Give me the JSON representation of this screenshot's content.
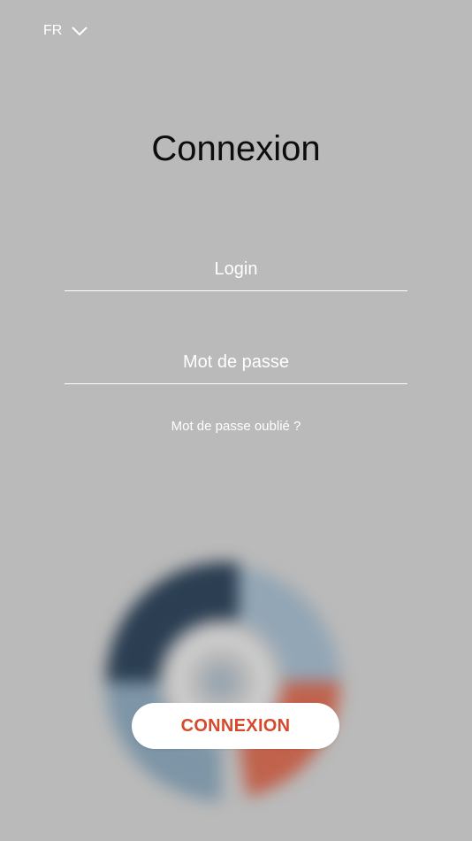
{
  "language": {
    "selected": "FR",
    "chevron_icon": "chevron-down-icon"
  },
  "title": "Connexion",
  "form": {
    "login_placeholder": "Login",
    "password_placeholder": "Mot de passe",
    "forgot_password": "Mot de passe oublié ?"
  },
  "actions": {
    "submit_label": "CONNEXION"
  },
  "colors": {
    "background": "#bababa",
    "accent": "#d54a2c",
    "logo_dark": "#2b3e52",
    "logo_mid": "#8fa3b3",
    "logo_teal": "#6f8ea0",
    "logo_red": "#c0624c"
  }
}
